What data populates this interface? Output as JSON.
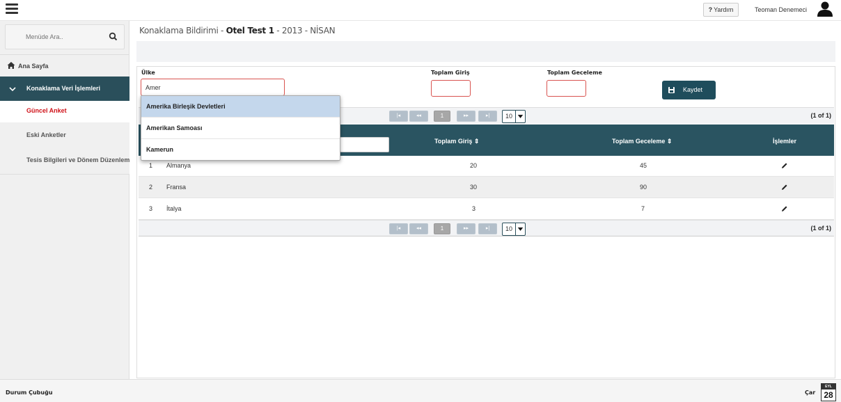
{
  "header": {
    "help_label": "Yardım",
    "help_mark": "?",
    "user_name": "Teoman Denemeci"
  },
  "sidebar": {
    "search_placeholder": "Menüde Ara..",
    "items": [
      {
        "label": "Ana Sayfa",
        "icon": "home-icon"
      },
      {
        "label": "Konaklama Veri İşlemleri",
        "icon": "chevron-down-icon"
      }
    ],
    "sub_items": [
      {
        "label": "Güncel Anket",
        "active": true
      },
      {
        "label": "Eski Anketler"
      },
      {
        "label": "Tesis Bilgileri ve Dönem Düzenleme"
      }
    ]
  },
  "page": {
    "title_prefix": "Konaklama Bildirimi - ",
    "title_bold": "Otel Test 1",
    "title_suffix": " - 2013 - NİSAN"
  },
  "form": {
    "country_label": "Ülke",
    "country_value": "Amer",
    "total_entries_label": "Toplam Giriş",
    "total_nights_label": "Toplam Geceleme",
    "save_label": "Kaydet"
  },
  "autocomplete": {
    "options": [
      "Amerika Birleşik Devletleri",
      "Amerikan Samoası",
      "Kamerun"
    ]
  },
  "pager": {
    "first": "|◂",
    "prev": "◂◂",
    "page": "1",
    "next": "▸▸",
    "last": "▸|",
    "page_size": "10",
    "count": "(1 of 1)"
  },
  "table": {
    "columns": [
      "Toplam Giriş",
      "Toplam Geceleme",
      "İşlemler"
    ],
    "sort_glyph": "⇕",
    "rows": [
      {
        "no": "1",
        "country": "Almanya",
        "entries": "20",
        "nights": "45"
      },
      {
        "no": "2",
        "country": "Fransa",
        "entries": "30",
        "nights": "90"
      },
      {
        "no": "3",
        "country": "İtalya",
        "entries": "3",
        "nights": "7"
      }
    ]
  },
  "statusbar": {
    "label": "Durum Çubuğu",
    "day_name": "Çar",
    "month": "EYL",
    "day": "28"
  },
  "colors": {
    "accent": "#2a5461",
    "danger": "#d9534f",
    "active_menu": "#d0131a"
  }
}
